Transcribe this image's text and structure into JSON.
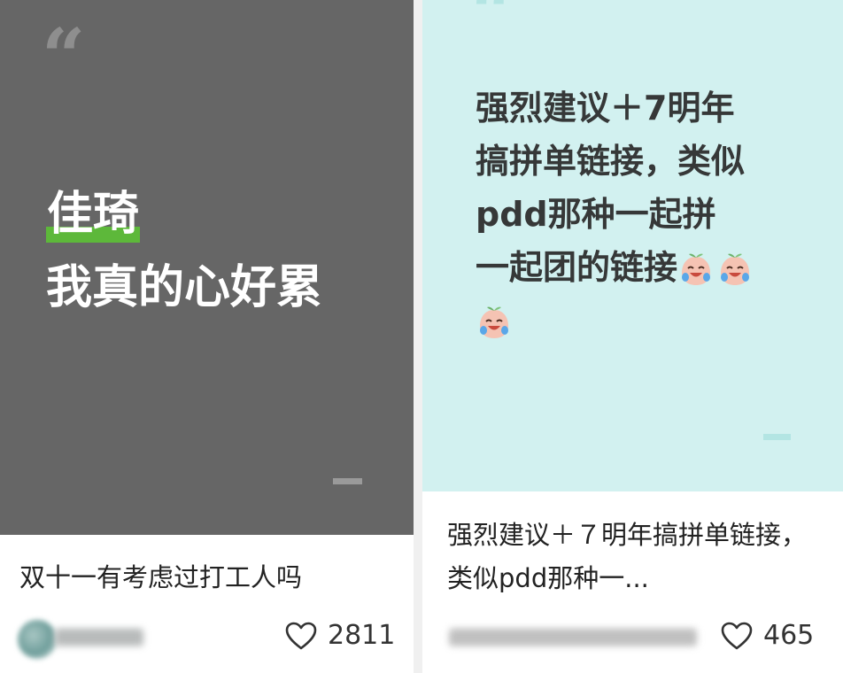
{
  "cards": [
    {
      "cover": {
        "quote_mark": "“",
        "highlight_text": "佳琦",
        "main_text": "我真的心好累",
        "background_color": "#666666",
        "highlight_color": "#5db83a"
      },
      "title": "双十一有考虑过打工人吗",
      "likes": "2811",
      "like_icon": "heart-outline-icon"
    },
    {
      "cover": {
        "quote_mark": "“",
        "lines": [
          "强烈建议＋7明年",
          "搞拼单链接，类似",
          "pdd那种一起拼",
          "一起团的链接"
        ],
        "emoji_name": "crying-laughing-peach-emoji",
        "background_color": "#d2f1f0"
      },
      "title": "强烈建议＋７明年搞拼单链接，类似pdd那种一...",
      "likes": "465",
      "like_icon": "heart-outline-icon"
    }
  ]
}
